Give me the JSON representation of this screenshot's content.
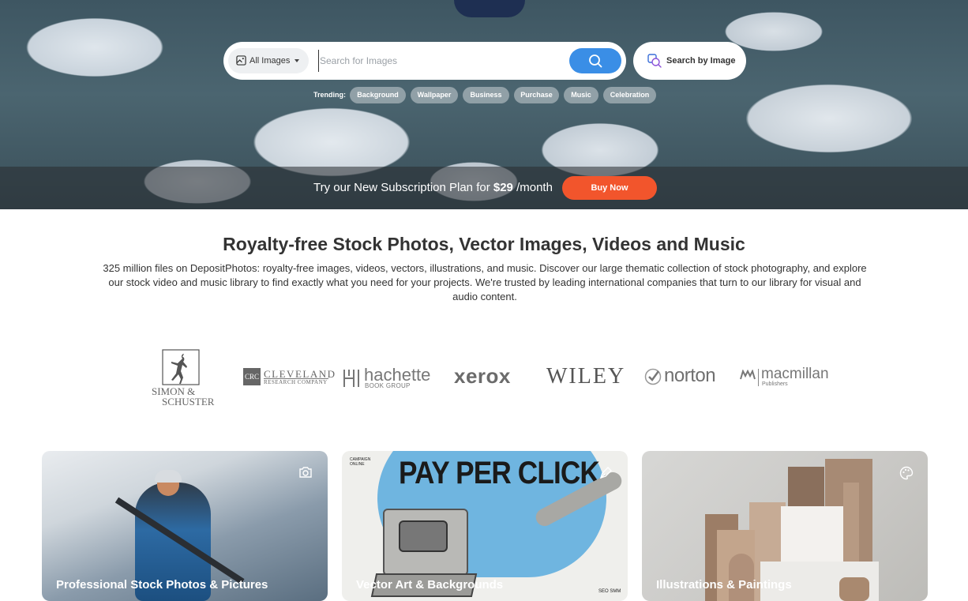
{
  "search": {
    "category": "All Images",
    "placeholder": "Search for Images",
    "by_image_label": "Search by Image"
  },
  "trending": {
    "label": "Trending:",
    "chips": [
      "Background",
      "Wallpaper",
      "Business",
      "Purchase",
      "Music",
      "Celebration"
    ]
  },
  "promo": {
    "text_before": "Try our New Subscription Plan for",
    "price": "$29",
    "text_after": "/month",
    "button": "Buy Now"
  },
  "intro": {
    "headline": "Royalty-free Stock Photos, Vector Images, Videos and Music",
    "description": "325 million files on DepositPhotos: royalty-free images, videos, vectors, illustrations, and music. Discover our large thematic collection of stock photography, and explore our stock video and music library to find exactly what you need for your projects. We're trusted by leading international companies that turn to our library for visual and audio content."
  },
  "logos": {
    "simon_line1": "SIMON &",
    "simon_line2": "SCHUSTER",
    "cleveland_mark": "CRC",
    "cleveland_line1": "CLEVELAND",
    "cleveland_line2": "RESEARCH COMPANY",
    "hachette_line1": "hachette",
    "hachette_line2": "BOOK GROUP",
    "xerox": "xerox",
    "wiley": "WILEY",
    "norton": "norton",
    "macmillan_line1": "macmillan",
    "macmillan_line2": "Publishers"
  },
  "cards": [
    {
      "label": "Professional Stock Photos & Pictures",
      "icon": "camera-icon"
    },
    {
      "label": "Vector Art & Backgrounds",
      "icon": "vector-pen-icon",
      "image_text": "PAY PER CLICK",
      "badge": "CAMPAIGN ONLINE",
      "corner": "SEO SMM"
    },
    {
      "label": "Illustrations & Paintings",
      "icon": "palette-icon"
    }
  ]
}
